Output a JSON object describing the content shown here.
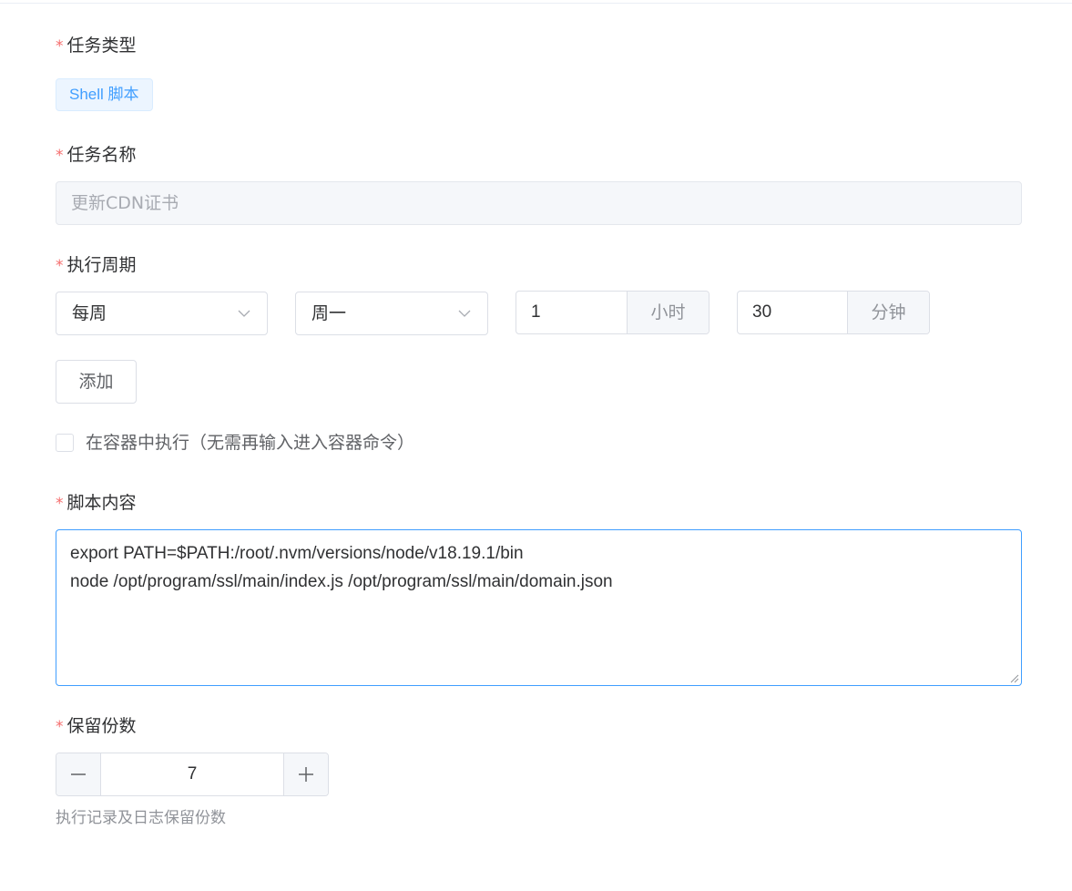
{
  "form": {
    "task_type": {
      "label": "任务类型",
      "required_mark": "*",
      "tag": "Shell 脚本"
    },
    "task_name": {
      "label": "任务名称",
      "required_mark": "*",
      "value": "更新CDN证书"
    },
    "schedule": {
      "label": "执行周期",
      "required_mark": "*",
      "frequency": "每周",
      "weekday": "周一",
      "hour_value": "1",
      "hour_unit": "小时",
      "minute_value": "30",
      "minute_unit": "分钟",
      "add_button": "添加"
    },
    "in_container": {
      "label": "在容器中执行（无需再输入进入容器命令）",
      "checked": false
    },
    "script": {
      "label": "脚本内容",
      "required_mark": "*",
      "line1": "export PATH=$PATH:/root/.nvm/versions/node/v18.19.1/bin",
      "line2": "node /opt/program/ssl/main/index.js /opt/program/ssl/main/domain.json"
    },
    "retention": {
      "label": "保留份数",
      "required_mark": "*",
      "value": "7",
      "hint": "执行记录及日志保留份数"
    }
  },
  "colors": {
    "required": "#f56c6c",
    "accent": "#409eff",
    "border": "#dcdfe6"
  },
  "icons": {
    "select_arrow": "chevron-down-icon",
    "decrement": "minus-icon",
    "increment": "plus-icon"
  }
}
